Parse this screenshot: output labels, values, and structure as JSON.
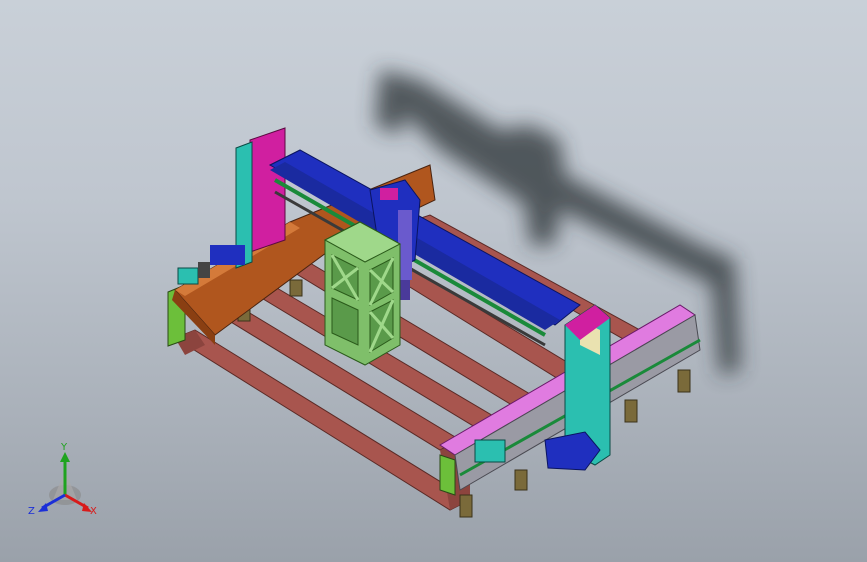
{
  "triad": {
    "x_label": "X",
    "y_label": "Y",
    "z_label": "Z",
    "x_color": "#d81b1b",
    "y_color": "#1fa31f",
    "z_color": "#1b2fd8"
  },
  "colors": {
    "frame_rails": "#a8554e",
    "gantry_blue": "#1f2fbf",
    "beam_orange": "#b0561e",
    "cage_green": "#7fbf6a",
    "side_pink": "#e07be0",
    "post_cyan": "#2bbfb0",
    "end_green": "#6cbf3a",
    "accent_magenta": "#d01fa0"
  }
}
